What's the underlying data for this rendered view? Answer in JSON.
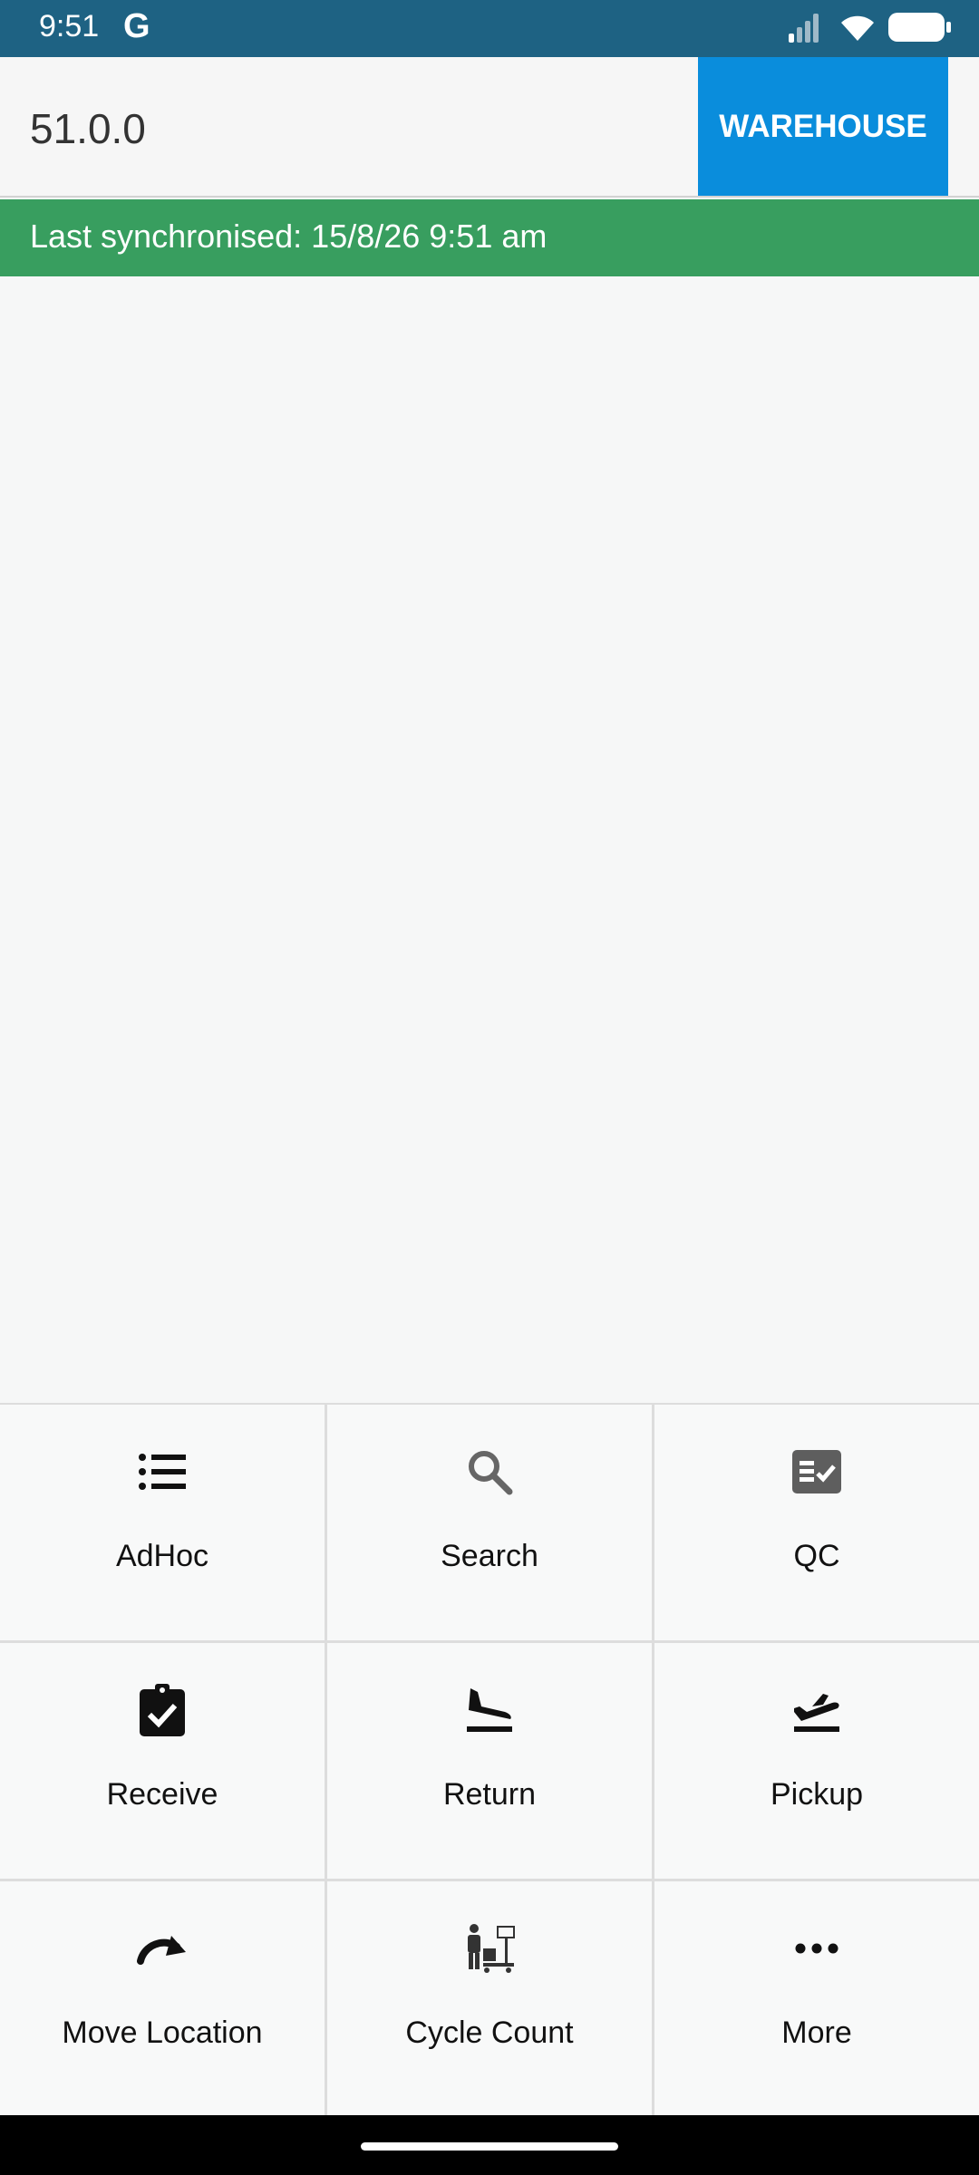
{
  "status_bar": {
    "time": "9:51",
    "g_label": "G",
    "icons": [
      "signal-icon",
      "wifi-icon",
      "battery-icon"
    ]
  },
  "header": {
    "version": "51.0.0",
    "warehouse_label": "WAREHOUSE"
  },
  "sync": {
    "text": "Last synchronised: 15/8/26 9:51 am"
  },
  "tiles": [
    {
      "label": "AdHoc",
      "icon": "list-icon"
    },
    {
      "label": "Search",
      "icon": "search-icon"
    },
    {
      "label": "QC",
      "icon": "checklist-icon"
    },
    {
      "label": "Receive",
      "icon": "clipboard-check-icon"
    },
    {
      "label": "Return",
      "icon": "flight-land-icon"
    },
    {
      "label": "Pickup",
      "icon": "flight-takeoff-icon"
    },
    {
      "label": "Move Location",
      "icon": "redo-arrow-icon"
    },
    {
      "label": "Cycle Count",
      "icon": "warehouse-worker-icon"
    },
    {
      "label": "More",
      "icon": "more-dots-icon"
    }
  ],
  "colors": {
    "status_bar": "#1e6283",
    "warehouse_button": "#0a8ddc",
    "sync_bar": "#389e5f"
  }
}
